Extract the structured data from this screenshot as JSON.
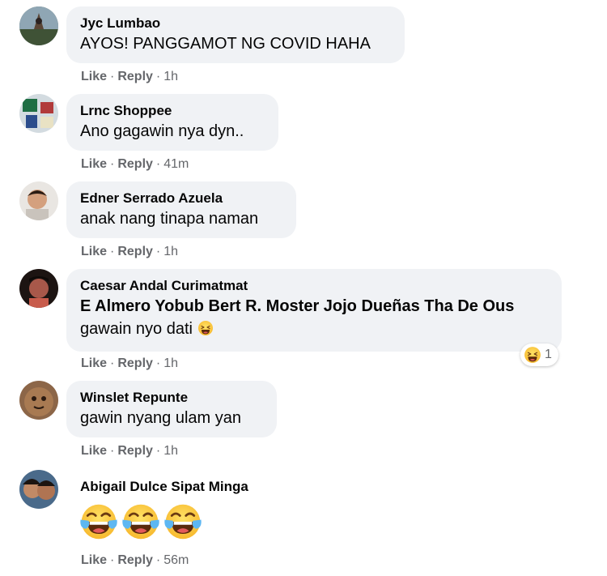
{
  "comments": [
    {
      "name": "Jyc Lumbao",
      "text": "AYOS! PANGGAMOT NG COVID HAHA",
      "like": "Like",
      "reply": "Reply",
      "time": "1h"
    },
    {
      "name": "Lrnc Shoppee",
      "text": "Ano gagawin nya dyn..",
      "like": "Like",
      "reply": "Reply",
      "time": "41m"
    },
    {
      "name": "Edner Serrado Azuela",
      "text": "anak nang tinapa naman",
      "like": "Like",
      "reply": "Reply",
      "time": "1h"
    },
    {
      "name": "Caesar Andal Curimatmat",
      "tags": "E Almero Yobub Bert R. Moster Jojo Dueñas Tha De Ous",
      "text": "gawain nyo dati",
      "like": "Like",
      "reply": "Reply",
      "time": "1h",
      "reaction_count": "1",
      "reaction_icon": "laughing-face-icon"
    },
    {
      "name": "Winslet Repunte",
      "text": "gawin nyang ulam yan",
      "like": "Like",
      "reply": "Reply",
      "time": "1h"
    },
    {
      "name": "Abigail Dulce Sipat Minga",
      "like": "Like",
      "reply": "Reply",
      "time": "56m",
      "emoji_count": 3,
      "emoji_icon": "tears-of-joy-icon"
    }
  ],
  "separator": "·",
  "colors": {
    "bubble": "#f0f2f5",
    "meta": "#65676b",
    "text": "#050505"
  }
}
